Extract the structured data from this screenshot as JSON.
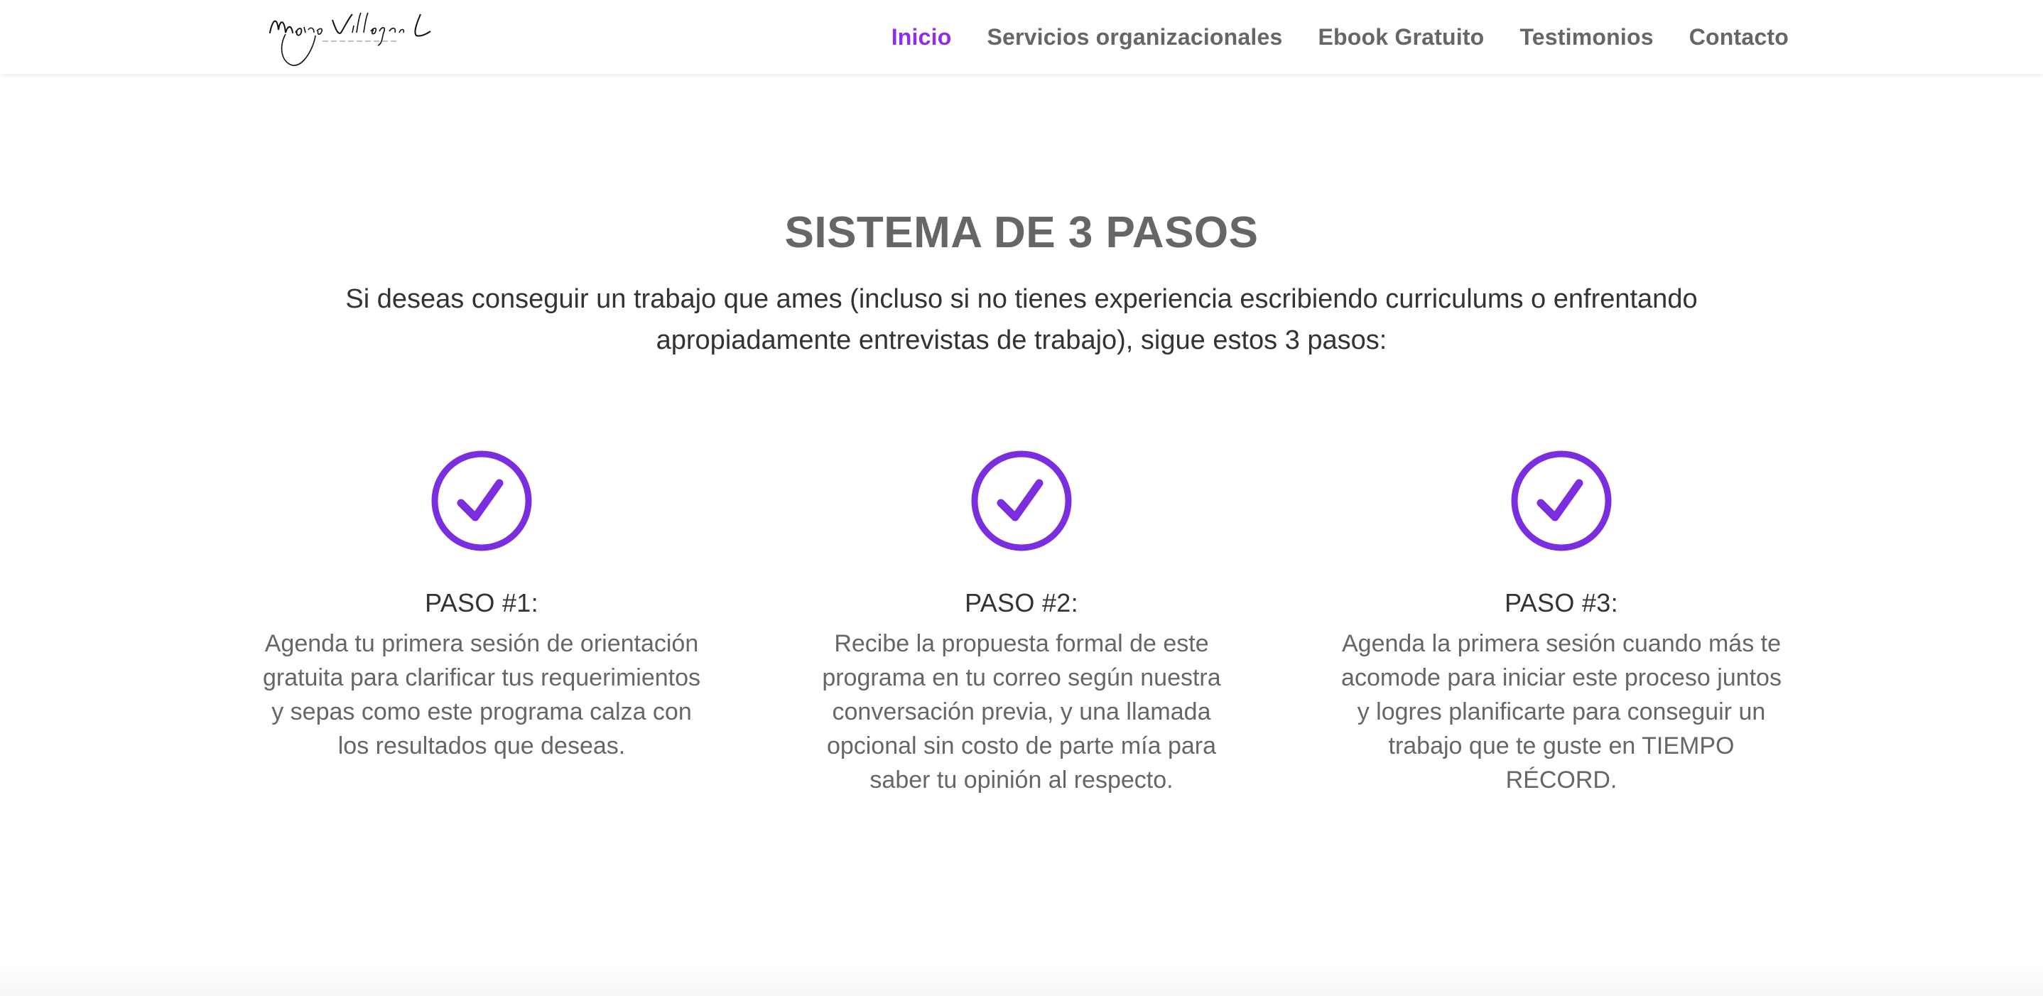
{
  "header": {
    "nav": [
      {
        "label": "Inicio",
        "active": true
      },
      {
        "label": "Servicios organizacionales",
        "active": false
      },
      {
        "label": "Ebook Gratuito",
        "active": false
      },
      {
        "label": "Testimonios",
        "active": false
      },
      {
        "label": "Contacto",
        "active": false
      }
    ]
  },
  "main": {
    "title": "SISTEMA DE 3 PASOS",
    "intro": "Si deseas conseguir un trabajo que ames (incluso si no tienes experiencia escribiendo curriculums o enfrentando apropiadamente entrevistas de trabajo), sigue estos 3 pasos:",
    "steps": [
      {
        "icon": "check-circle-icon",
        "title": "PASO #1:",
        "text": "Agenda tu primera sesión de orientación gratuita para clarificar tus requerimientos y sepas como este programa calza con los resultados que deseas."
      },
      {
        "icon": "check-circle-icon",
        "title": "PASO #2:",
        "text": "Recibe la propuesta formal de este programa en tu correo según nuestra conversación previa, y una llamada opcional sin costo de parte mía para saber tu opinión al respecto."
      },
      {
        "icon": "check-circle-icon",
        "title": "PASO #3:",
        "text": "Agenda la primera sesión cuando más te acomode para iniciar este proceso juntos y logres planificarte para conseguir un trabajo que te guste en TIEMPO RÉCORD."
      }
    ]
  },
  "colors": {
    "accent": "#8f2cf0",
    "icon": "#7a2ee0",
    "heading": "#666666",
    "body_dark": "#333333",
    "body": "#666666"
  }
}
